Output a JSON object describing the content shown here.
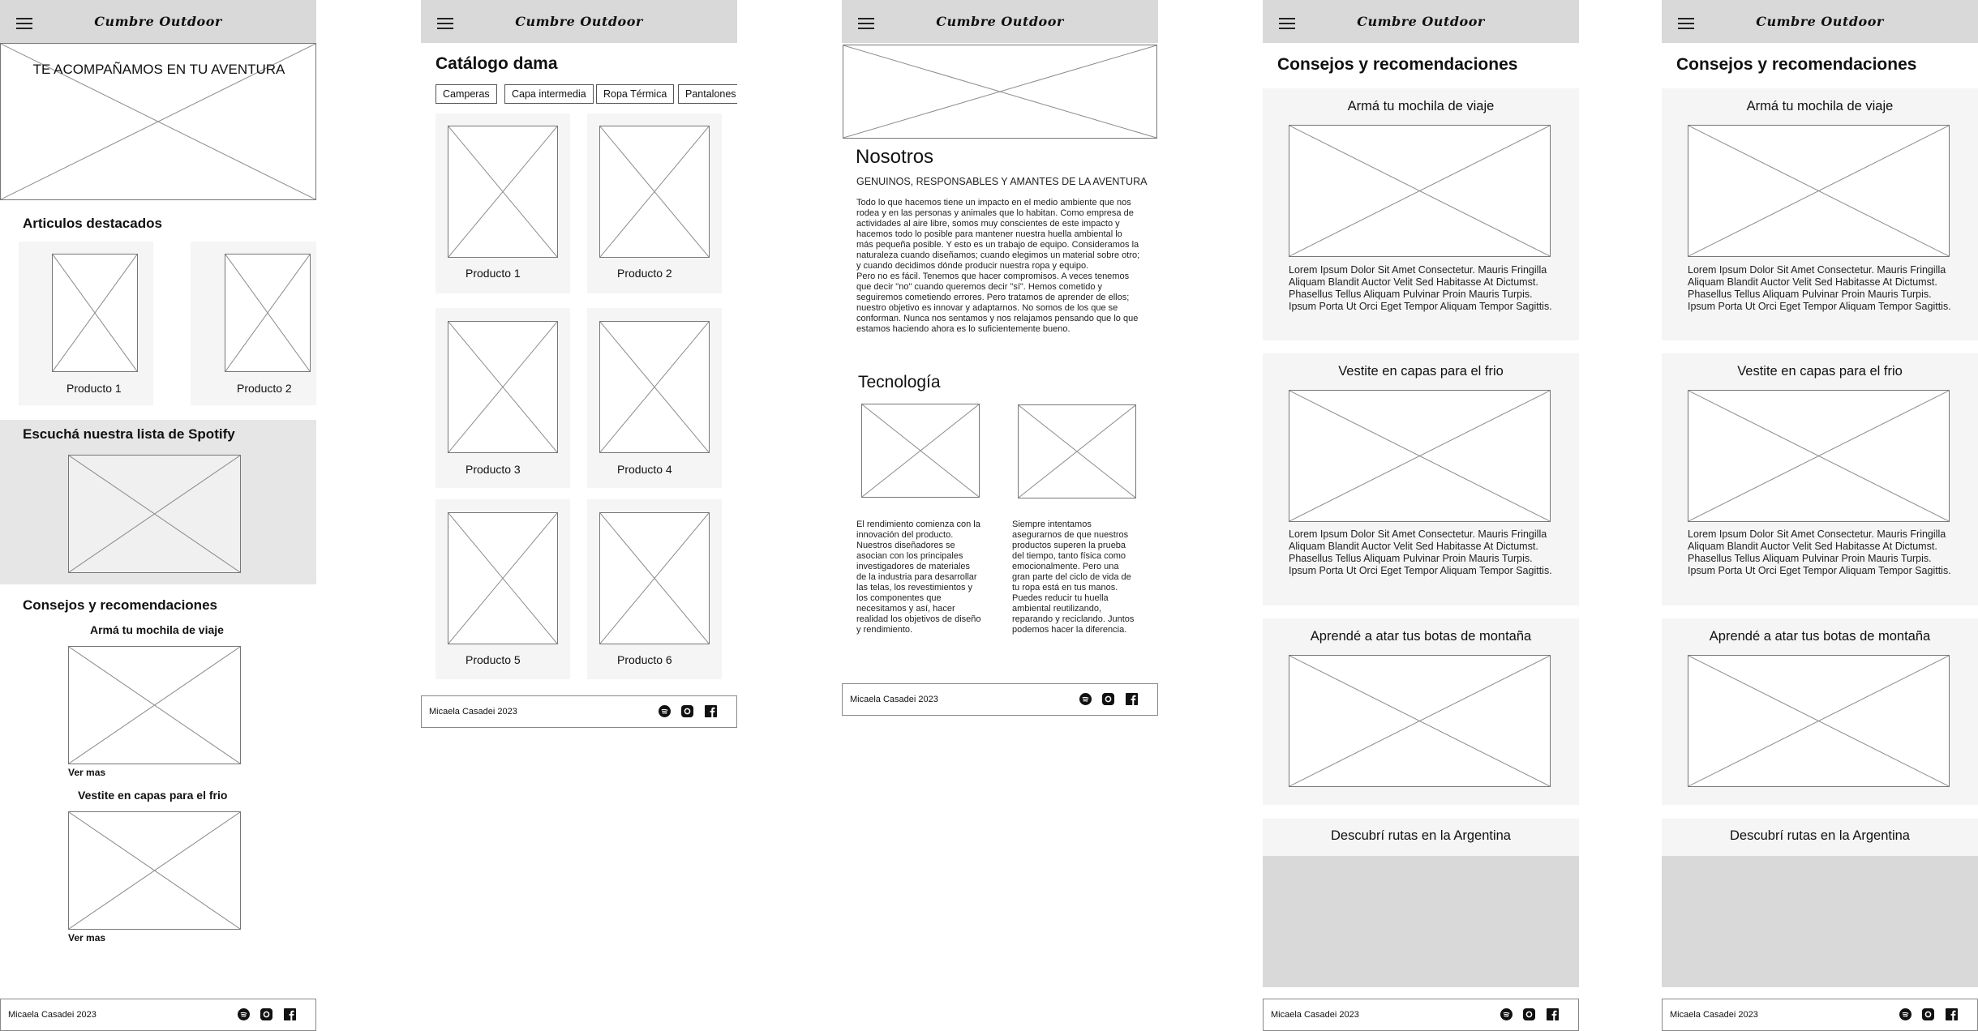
{
  "brand": "Cumbre Outdoor",
  "footer_text": "Micaela Casadei 2023",
  "icons": [
    "menu-icon",
    "spotify-icon",
    "instagram-icon",
    "facebook-icon",
    "placeholder-image-icon"
  ],
  "home": {
    "hero_text": "TE ACOMPAÑAMOS EN TU AVENTURA",
    "featured_title": "Articulos destacados",
    "featured": [
      "Producto 1",
      "Producto 2"
    ],
    "spotify_title": "Escuchá nuestra lista de Spotify",
    "tips_title": "Consejos y recomendaciones",
    "tips": [
      {
        "title": "Armá tu mochila de viaje",
        "link": "Ver mas"
      },
      {
        "title": "Vestite en capas para el frio",
        "link": "Ver mas"
      }
    ]
  },
  "catalog": {
    "title": "Catálogo dama",
    "chips": [
      "Camperas",
      "Capa intermedia",
      "Ropa Térmica",
      "Pantalones"
    ],
    "products": [
      "Producto 1",
      "Producto 2",
      "Producto 3",
      "Producto 4",
      "Producto 5",
      "Producto 6"
    ]
  },
  "about": {
    "title": "Nosotros",
    "subtitle": "GENUINOS,  RESPONSABLES Y AMANTES DE LA AVENTURA",
    "body": "Todo lo que hacemos tiene un impacto en el medio ambiente que nos rodea y en las personas y animales que lo habitan. Como empresa de actividades al aire libre, somos muy conscientes de este impacto y hacemos todo lo posible para mantener nuestra huella ambiental lo más pequeña posible. Y esto es un trabajo de equipo. Consideramos la naturaleza cuando diseñamos; cuando elegimos un material sobre otro; y cuando decidimos dónde producir nuestra ropa y equipo.\nPero no es fácil. Tenemos que hacer compromisos. A veces tenemos que decir \"no\" cuando queremos decir \"sí\". Hemos cometido y seguiremos cometiendo errores. Pero tratamos de aprender de ellos; nuestro objetivo es innovar y adaptarnos. No somos de los que se conforman. Nunca nos sentamos y nos relajamos pensando que lo que estamos haciendo ahora es lo suficientemente bueno.",
    "tech_title": "Tecnología",
    "tech_left": "El rendimiento comienza con la innovación del producto. Nuestros diseñadores se asocian con los principales investigadores de materiales de la industria para desarrollar las telas, los revestimientos y los componentes que necesitamos y así, hacer realidad los objetivos de diseño y rendimiento.",
    "tech_right": "Siempre intentamos asegurarnos de que nuestros productos superen la prueba del tiempo, tanto física como emocionalmente. Pero una gran parte del ciclo de vida de tu ropa está en tus manos. Puedes reducir tu huella ambiental reutilizando, reparando y reciclando. Juntos podemos hacer la diferencia."
  },
  "tips_page": {
    "title": "Consejos y recomendaciones",
    "cards": [
      {
        "title": "Armá tu mochila de viaje",
        "text": "Lorem Ipsum Dolor Sit Amet Consectetur. Mauris Fringilla Aliquam Blandit Auctor Velit Sed Habitasse At Dictumst. Phasellus Tellus Aliquam Pulvinar Proin Mauris Turpis. Ipsum Porta Ut Orci Eget Tempor Aliquam Tempor Sagittis."
      },
      {
        "title": "Vestite en capas para el frio",
        "text": "Lorem Ipsum Dolor Sit Amet Consectetur. Mauris Fringilla Aliquam Blandit Auctor Velit Sed Habitasse At Dictumst. Phasellus Tellus Aliquam Pulvinar Proin Mauris Turpis. Ipsum Porta Ut Orci Eget Tempor Aliquam Tempor Sagittis."
      },
      {
        "title": "Aprendé a atar tus botas de montaña",
        "text": ""
      },
      {
        "title": "Descubrí rutas en la Argentina",
        "text": ""
      }
    ]
  }
}
